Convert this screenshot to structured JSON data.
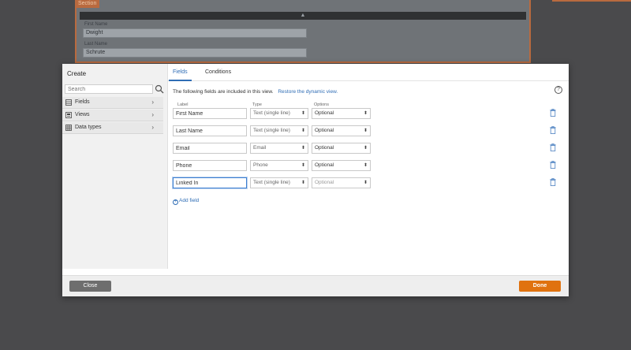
{
  "background_form": {
    "section_tab": "Section",
    "collapse_glyph": "▲",
    "fields": [
      {
        "label": "First Name",
        "value": "Dwight"
      },
      {
        "label": "Last Name",
        "value": "Schrute"
      }
    ]
  },
  "sidebar": {
    "title": "Create",
    "search_placeholder": "Search",
    "items": [
      {
        "label": "Fields",
        "icon": "fields-icon"
      },
      {
        "label": "Views",
        "icon": "views-icon"
      },
      {
        "label": "Data types",
        "icon": "data-types-icon"
      }
    ]
  },
  "tabs": [
    {
      "label": "Fields",
      "active": true
    },
    {
      "label": "Conditions",
      "active": false
    }
  ],
  "help_glyph": "?",
  "intro": {
    "text": "The following fields are included in this view.",
    "link": "Restore the dynamic view."
  },
  "columns": {
    "label": "Label",
    "type": "Type",
    "options": "Options"
  },
  "rows": [
    {
      "label": "First Name",
      "type": "Text (single line)",
      "option": "Optional"
    },
    {
      "label": "Last Name",
      "type": "Text (single line)",
      "option": "Optional"
    },
    {
      "label": "Email",
      "type": "Email",
      "option": "Optional"
    },
    {
      "label": "Phone",
      "type": "Phone",
      "option": "Optional"
    },
    {
      "label": "Linked In",
      "type": "Text (single line)",
      "option": "Optional"
    }
  ],
  "add_field": "Add field",
  "footer": {
    "close": "Close",
    "done": "Done"
  },
  "colors": {
    "accent": "#2f6db5",
    "done": "#e0720f",
    "close": "#6e6e6e"
  }
}
